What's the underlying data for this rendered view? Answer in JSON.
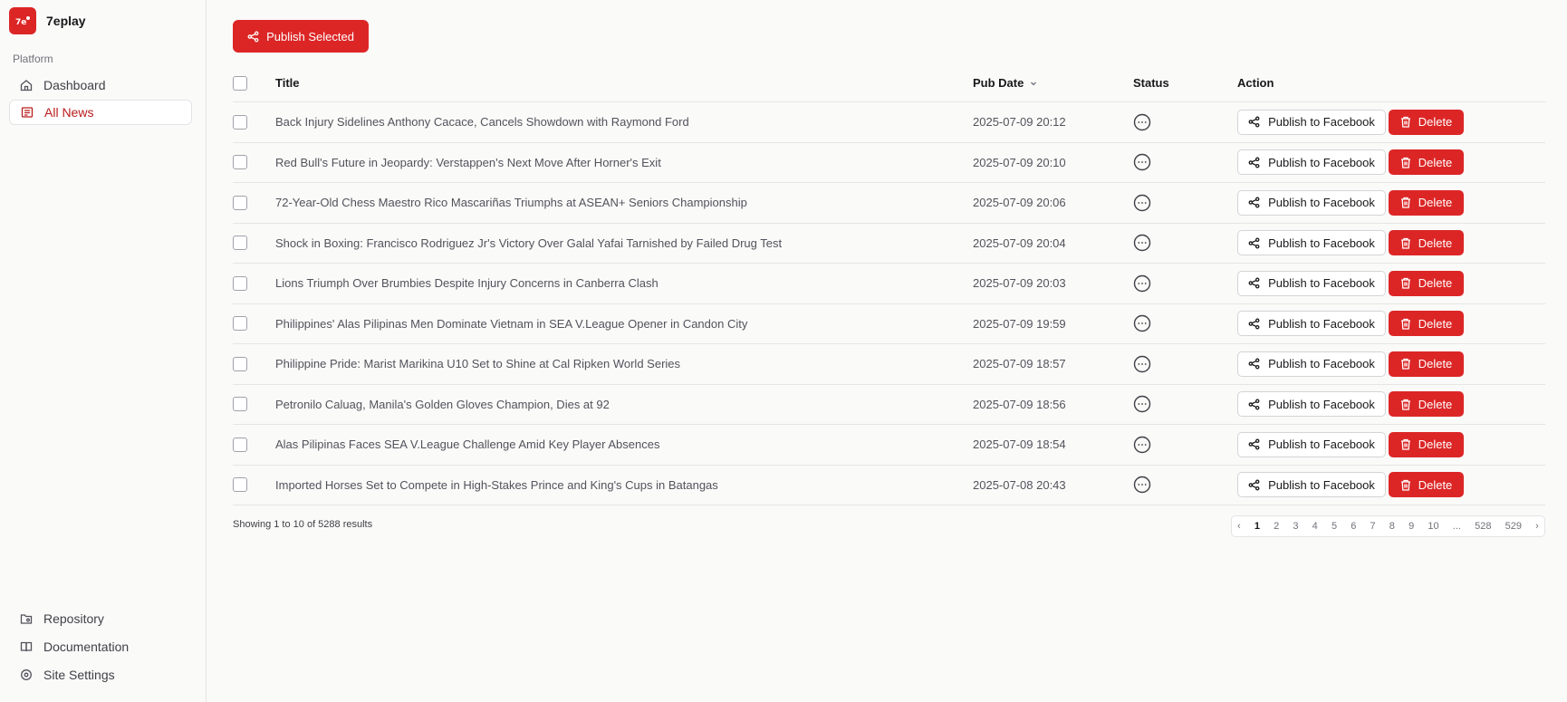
{
  "app": {
    "name": "7eplay"
  },
  "sidebar": {
    "section_label": "Platform",
    "items": [
      {
        "label": "Dashboard",
        "icon": "home-icon"
      },
      {
        "label": "All News",
        "icon": "newspaper-icon",
        "active": true
      }
    ],
    "footer_items": [
      {
        "label": "Repository",
        "icon": "folder-git-icon"
      },
      {
        "label": "Documentation",
        "icon": "book-icon"
      },
      {
        "label": "Site Settings",
        "icon": "gear-icon"
      }
    ]
  },
  "toolbar": {
    "publish_selected_label": "Publish Selected"
  },
  "table": {
    "columns": {
      "title": "Title",
      "pub_date": "Pub Date",
      "status": "Status",
      "action": "Action"
    },
    "rows": [
      {
        "title": "Back Injury Sidelines Anthony Cacace, Cancels Showdown with Raymond Ford",
        "pub_date": "2025-07-09 20:12"
      },
      {
        "title": "Red Bull's Future in Jeopardy: Verstappen's Next Move After Horner's Exit",
        "pub_date": "2025-07-09 20:10"
      },
      {
        "title": "72-Year-Old Chess Maestro Rico Mascariñas Triumphs at ASEAN+ Seniors Championship",
        "pub_date": "2025-07-09 20:06"
      },
      {
        "title": "Shock in Boxing: Francisco Rodriguez Jr's Victory Over Galal Yafai Tarnished by Failed Drug Test",
        "pub_date": "2025-07-09 20:04"
      },
      {
        "title": "Lions Triumph Over Brumbies Despite Injury Concerns in Canberra Clash",
        "pub_date": "2025-07-09 20:03"
      },
      {
        "title": "Philippines' Alas Pilipinas Men Dominate Vietnam in SEA V.League Opener in Candon City",
        "pub_date": "2025-07-09 19:59"
      },
      {
        "title": "Philippine Pride: Marist Marikina U10 Set to Shine at Cal Ripken World Series",
        "pub_date": "2025-07-09 18:57"
      },
      {
        "title": "Petronilo Caluag, Manila's Golden Gloves Champion, Dies at 92",
        "pub_date": "2025-07-09 18:56"
      },
      {
        "title": "Alas Pilipinas Faces SEA V.League Challenge Amid Key Player Absences",
        "pub_date": "2025-07-09 18:54"
      },
      {
        "title": "Imported Horses Set to Compete in High-Stakes Prince and King's Cups in Batangas",
        "pub_date": "2025-07-08 20:43"
      }
    ],
    "publish_label": "Publish to Facebook",
    "delete_label": "Delete"
  },
  "footer": {
    "showing_text": "Showing 1 to 10 of 5288 results",
    "pages": [
      "1",
      "2",
      "3",
      "4",
      "5",
      "6",
      "7",
      "8",
      "9",
      "10",
      "...",
      "528",
      "529"
    ],
    "current_page": "1",
    "prev_label": "‹",
    "next_label": "›"
  },
  "colors": {
    "accent": "#dc2626",
    "active_nav_text": "#b91c1c"
  }
}
